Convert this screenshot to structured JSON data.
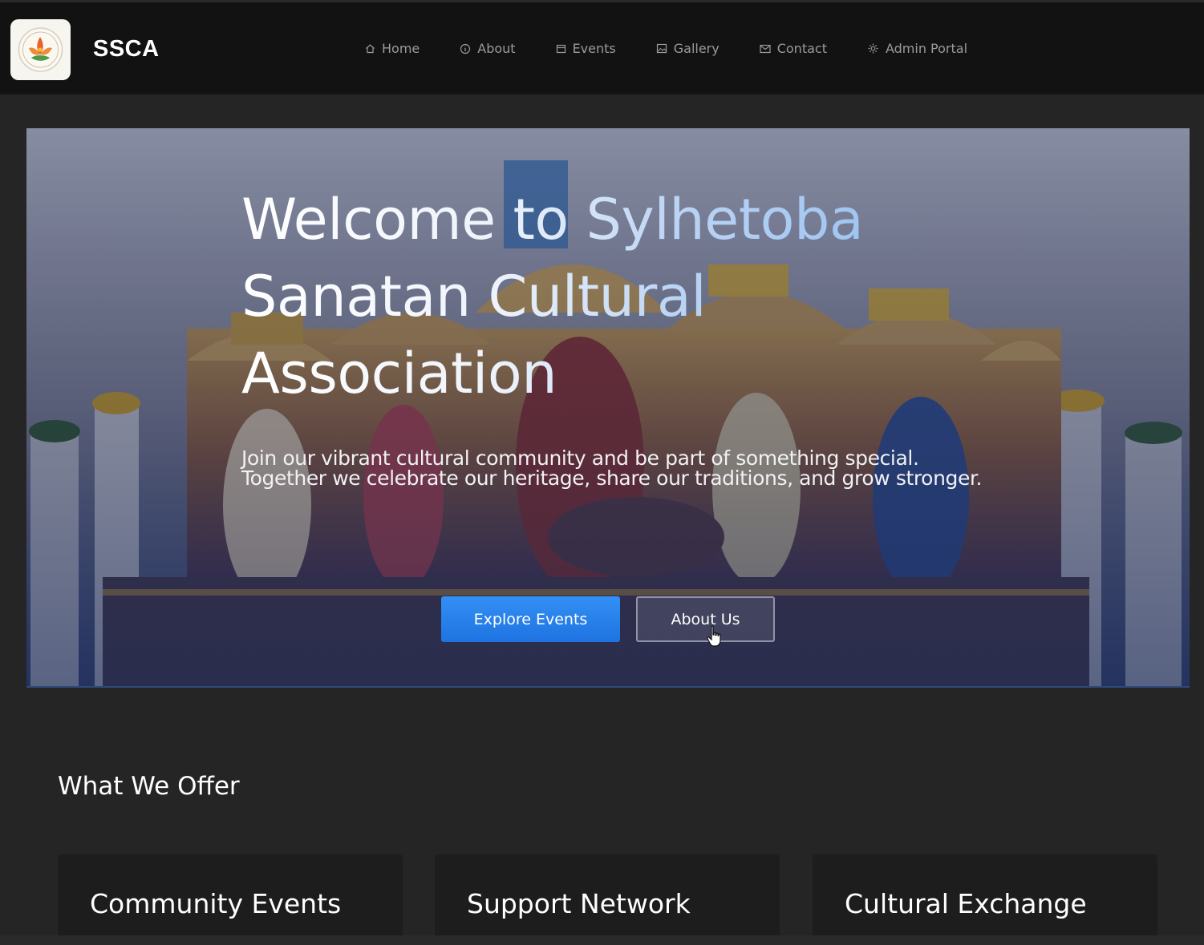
{
  "header": {
    "brand": "SSCA",
    "logo_icon": "lotus-logo-icon",
    "nav": [
      {
        "label": "Home",
        "icon": "home-icon"
      },
      {
        "label": "About",
        "icon": "info-icon"
      },
      {
        "label": "Events",
        "icon": "calendar-icon"
      },
      {
        "label": "Gallery",
        "icon": "image-icon"
      },
      {
        "label": "Contact",
        "icon": "mail-icon"
      },
      {
        "label": "Admin Portal",
        "icon": "gear-icon"
      }
    ]
  },
  "hero": {
    "title": "Welcome to Sylhetoba Sanatan Cultural Association",
    "subtitle": "Join our vibrant cultural community and be part of something special. Together we celebrate our heritage, share our traditions, and grow stronger.",
    "primary_button": "Explore Events",
    "secondary_button": "About Us",
    "accent_color": "#2680ec"
  },
  "offer": {
    "title": "What We Offer",
    "cards": [
      {
        "title": "Community Events"
      },
      {
        "title": "Support Network"
      },
      {
        "title": "Cultural Exchange"
      }
    ]
  }
}
